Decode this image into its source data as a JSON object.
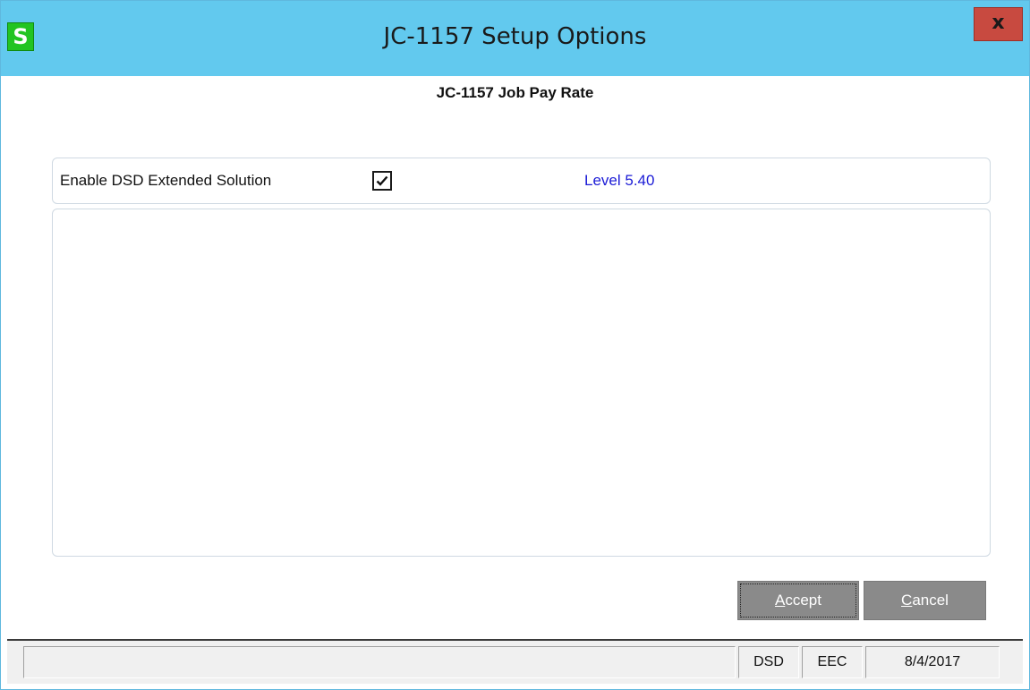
{
  "window": {
    "title": "JC-1157 Setup Options",
    "app_icon_letter": "S",
    "close_glyph": "x"
  },
  "form": {
    "subtitle": "JC-1157 Job Pay Rate",
    "enable_label": "Enable DSD Extended Solution",
    "enable_checked": true,
    "level": "Level  5.40"
  },
  "buttons": {
    "accept_mnemonic": "A",
    "accept_rest": "ccept",
    "cancel_mnemonic": "C",
    "cancel_rest": "ancel"
  },
  "statusbar": {
    "message": "",
    "company": "DSD",
    "user": "EEC",
    "date": "8/4/2017"
  },
  "colors": {
    "titlebar": "#62c9ee",
    "close_button": "#c84a40",
    "app_icon": "#22c422",
    "level_text": "#1b1bd6",
    "buttons": "#8a8a8a"
  }
}
